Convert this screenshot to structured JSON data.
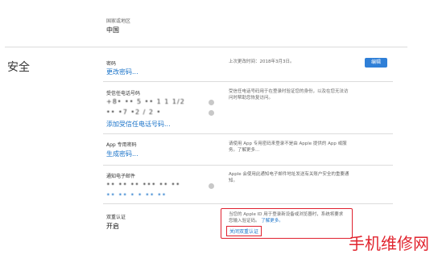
{
  "region": {
    "label": "国家或地区",
    "value": "中国"
  },
  "section_title": "安全",
  "password": {
    "label": "密码",
    "link": "更改密码...",
    "last_changed": "上次更改时间：2018年3月3日。",
    "edit_button": "编辑"
  },
  "trusted_phone": {
    "label": "受信任电话号码",
    "line1": "+8• ••  5 •• 1 1 1/2",
    "line2": "•• •7 •2 / 2 •",
    "link": "添加受信任电话号码...",
    "desc": "受信任电话号码用于在登录时验证您的身份，以及在您无法访问时帮助您恢复访问。"
  },
  "app_password": {
    "label": "App 专用密码",
    "link": "生成密码...",
    "desc": "请使用 App 专用密码来登录不是由 Apple 提供的 App 或服务。了解更多..."
  },
  "notify_email": {
    "label": "通知电子邮件",
    "line1": "•• •• •• ••• •• ••",
    "line2": "•• •• • •  •• ••",
    "desc": "Apple 会使用此通知电子邮件地址发送有关账户安全的重要通知。"
  },
  "two_factor": {
    "label": "双重认证",
    "value": "开启",
    "desc": "当您的 Apple ID 用于登录新设备或浏览器时，系统将要求您输入验证码。",
    "learn_more": "了解更多。",
    "turn_off_link": "关闭双重认证"
  },
  "watermark": "手机维修网",
  "colors": {
    "link": "#1a73c9",
    "button": "#2f7fd7",
    "highlight": "#e0212f",
    "watermark": "#e1252f"
  }
}
